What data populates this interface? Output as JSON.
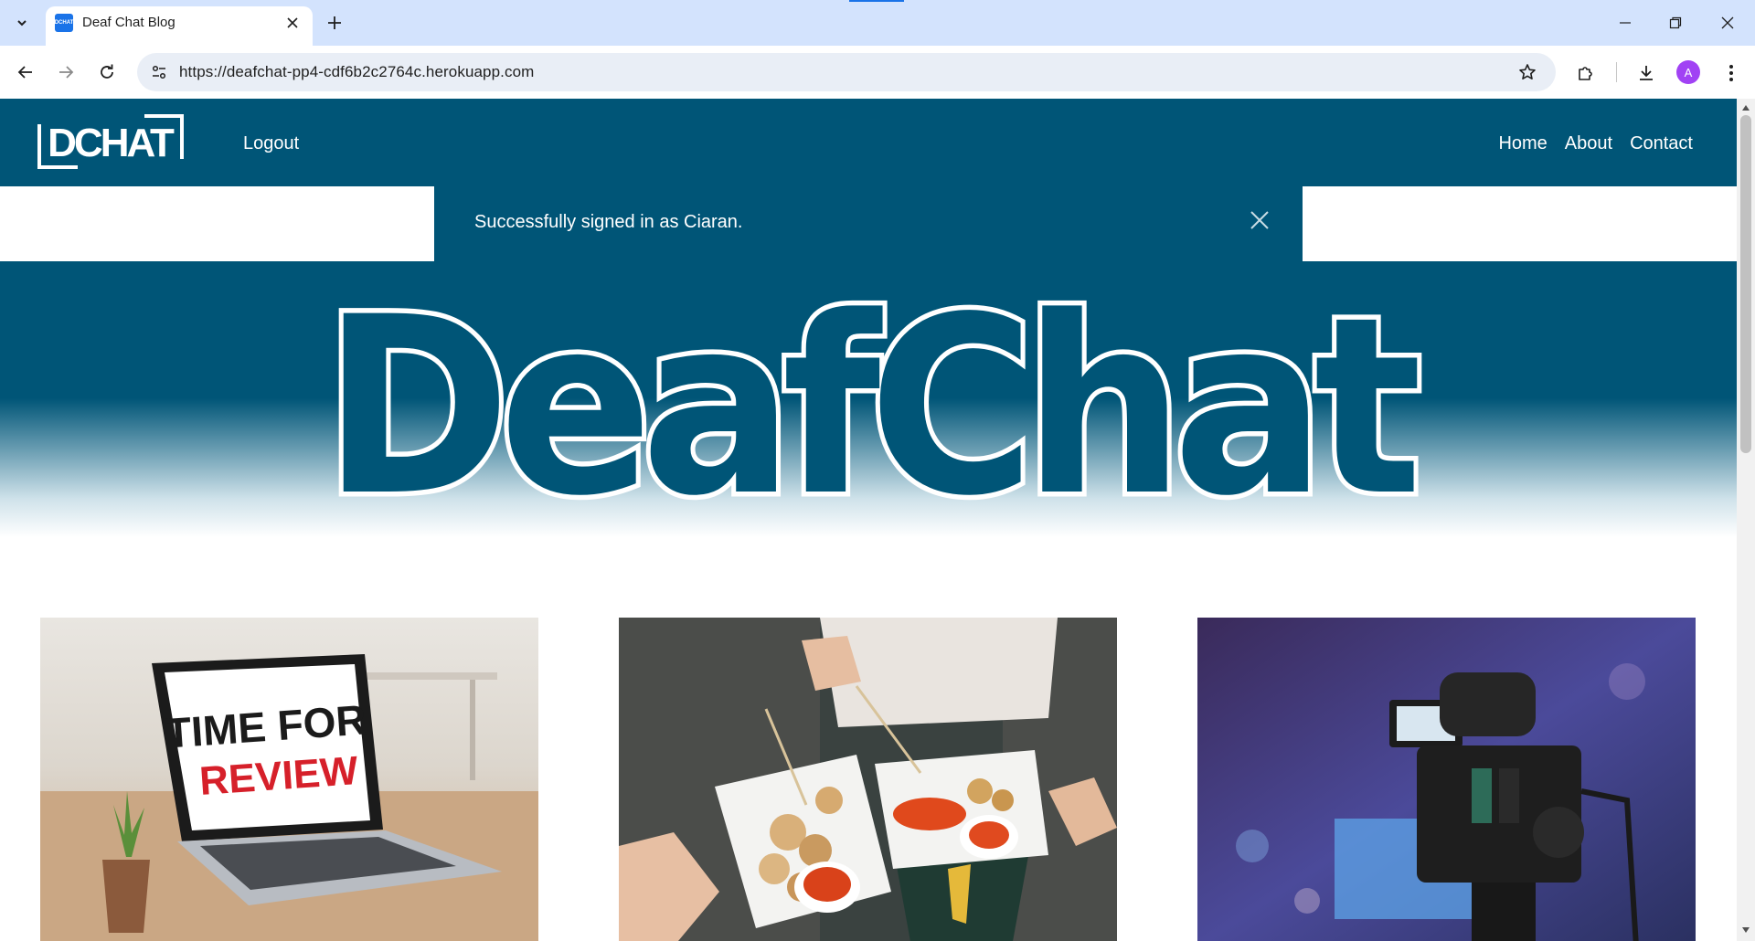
{
  "browser": {
    "tab_title": "Deaf Chat Blog",
    "favicon_text": "DCHAT",
    "url": "https://deafchat-pp4-cdf6b2c2764c.herokuapp.com",
    "profile_initial": "A"
  },
  "navbar": {
    "logo_text": "DCHAT",
    "logout_label": "Logout",
    "links": [
      {
        "label": "Home"
      },
      {
        "label": "About"
      },
      {
        "label": "Contact"
      }
    ]
  },
  "alert": {
    "message": "Successfully signed in as Ciaran."
  },
  "hero": {
    "title": "DeafChat"
  },
  "cards": [
    {
      "image_text_line1": "TIME FOR",
      "image_text_line2": "REVIEW",
      "image_icon": "laptop-image"
    },
    {
      "image_icon": "food-image"
    },
    {
      "image_icon": "video-camera-image"
    }
  ],
  "colors": {
    "brand": "#005577",
    "chrome_tabstrip": "#d3e3fd",
    "review_red": "#d6202a"
  }
}
